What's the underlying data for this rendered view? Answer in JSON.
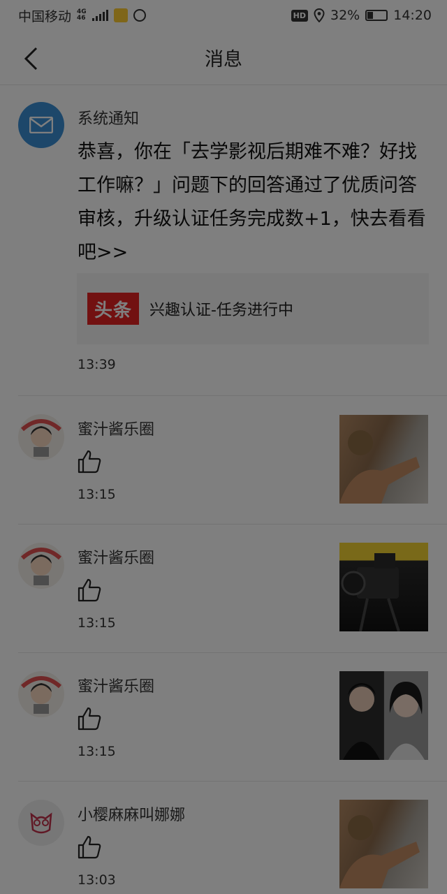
{
  "status_bar": {
    "carrier": "中国移动",
    "network": "4G",
    "network_sub": "46",
    "battery_percent": "32%",
    "battery_level": 0.32,
    "time": "14:20",
    "hd_label": "HD"
  },
  "header": {
    "title": "消息"
  },
  "system_notice": {
    "sender": "系统通知",
    "message": "恭喜，你在「去学影视后期难不难？好找工作嘛？」问题下的回答通过了优质问答审核，升级认证任务完成数+1，快去看看吧>>",
    "card_logo": "头条",
    "card_text": "兴趣认证-任务进行中",
    "time": "13:39"
  },
  "notifications": [
    {
      "sender": "蜜汁酱乐圈",
      "time": "13:15",
      "thumbnail": "castaway-still"
    },
    {
      "sender": "蜜汁酱乐圈",
      "time": "13:15",
      "thumbnail": "film-camera"
    },
    {
      "sender": "蜜汁酱乐圈",
      "time": "13:15",
      "thumbnail": "two-actors"
    },
    {
      "sender": "小樱麻麻叫娜娜",
      "time": "13:03",
      "thumbnail": "castaway-still"
    }
  ],
  "colors": {
    "mail_icon_bg": "#3b8fd4",
    "toutiao_red": "#e42322",
    "dim_overlay": "rgba(0,0,0,0.5)"
  }
}
